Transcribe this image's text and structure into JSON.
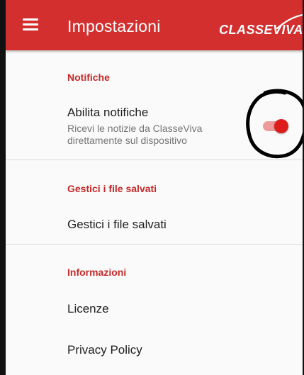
{
  "appbar": {
    "title": "Impostazioni",
    "logo_text": "CLASSEVIVA",
    "color": "#d32f2f"
  },
  "icons": {
    "menu": "hamburger-menu-icon"
  },
  "sections": {
    "notifiche": {
      "header": "Notifiche",
      "enable_title": "Abilita notifiche",
      "enable_summary": "Ricevi le notizie da ClasseViva direttamente sul dispositivo",
      "enabled": true
    },
    "files": {
      "header": "Gestici i file salvati",
      "item_title": "Gestici i file salvati"
    },
    "info": {
      "header": "Informazioni",
      "licenses": "Licenze",
      "privacy": "Privacy Policy"
    }
  },
  "colors": {
    "accent": "#c62828",
    "switch_thumb": "#dd1c1c",
    "switch_track": "#ef9a9a",
    "annotation": "#000000"
  }
}
